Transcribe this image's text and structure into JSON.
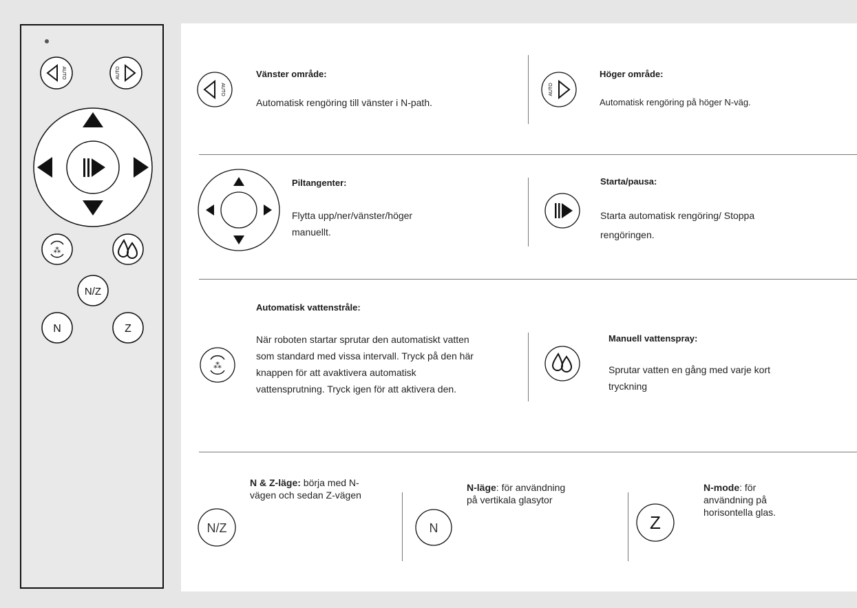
{
  "remote": {
    "buttons": {
      "nz_label": "N/Z",
      "n_label": "N",
      "z_label": "Z",
      "auto_label": "AUTO"
    }
  },
  "sections": {
    "left_area": {
      "title": "Vänster område:",
      "desc": "Automatisk rengöring till vänster i N-path."
    },
    "right_area": {
      "title": "Höger område:",
      "desc": "Automatisk rengöring på höger N-väg."
    },
    "arrows": {
      "title": "Piltangenter:",
      "desc_line1": "Flytta upp/ner/vänster/höger",
      "desc_line2": "manuellt."
    },
    "start_pause": {
      "title": "Starta/pausa:",
      "desc_line1": "Starta automatisk rengöring/ Stoppa",
      "desc_line2": "rengöringen."
    },
    "auto_spray": {
      "title": "Automatisk vattenstråle:",
      "desc_line1": "När roboten startar sprutar den automatiskt vatten",
      "desc_line2": "som standard med vissa intervall. Tryck på den här",
      "desc_line3": "knappen för att avaktivera automatisk",
      "desc_line4": "vattensprutning. Tryck igen för att aktivera den."
    },
    "manual_spray": {
      "title": "Manuell vattenspray:",
      "desc_line1": "Sprutar vatten en gång med varje kort",
      "desc_line2": "tryckning"
    },
    "nz_mode": {
      "bold": "N & Z-läge:",
      "text1": " börja med N-",
      "text2": "vägen och sedan Z-vägen",
      "icon_label": "N/Z"
    },
    "n_mode": {
      "bold": "N-läge",
      "text1": ": för användning",
      "text2": "på vertikala glasytor",
      "icon_label": "N"
    },
    "z_mode": {
      "bold": "N-mode",
      "text1": ": för",
      "text2": "användning på",
      "text3": "horisontella glas.",
      "icon_label": "Z"
    }
  }
}
